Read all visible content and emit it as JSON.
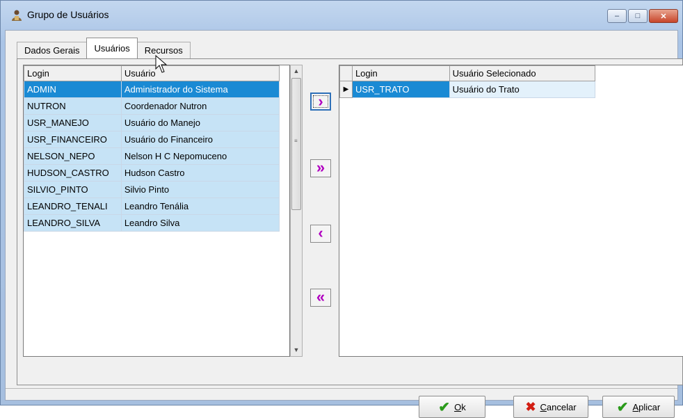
{
  "window": {
    "title": "Grupo de Usuários",
    "controls": {
      "minimize": "–",
      "maximize": "□",
      "close": "✕"
    }
  },
  "tabs": [
    {
      "label": "Dados Gerais",
      "active": false
    },
    {
      "label": "Usuários",
      "active": true
    },
    {
      "label": "Recursos",
      "active": false
    }
  ],
  "left_grid": {
    "columns": [
      "Login",
      "Usuário"
    ],
    "rows": [
      {
        "login": "ADMIN",
        "name": "Administrador do Sistema",
        "selected": true
      },
      {
        "login": "NUTRON",
        "name": "Coordenador Nutron"
      },
      {
        "login": "USR_MANEJO",
        "name": "Usuário do Manejo"
      },
      {
        "login": "USR_FINANCEIRO",
        "name": "Usuário do Financeiro"
      },
      {
        "login": "NELSON_NEPO",
        "name": "Nelson H C Nepomuceno"
      },
      {
        "login": "HUDSON_CASTRO",
        "name": "Hudson Castro"
      },
      {
        "login": "SILVIO_PINTO",
        "name": "Silvio Pinto"
      },
      {
        "login": "LEANDRO_TENALI",
        "name": "Leandro Tenália"
      },
      {
        "login": "LEANDRO_SILVA",
        "name": "Leandro Silva"
      }
    ]
  },
  "move_buttons": [
    {
      "symbol": "›",
      "icon": "move-right-icon"
    },
    {
      "symbol": "»",
      "icon": "move-all-right-icon"
    },
    {
      "symbol": "‹",
      "icon": "move-left-icon"
    },
    {
      "symbol": "«",
      "icon": "move-all-left-icon"
    }
  ],
  "right_grid": {
    "columns": [
      "Login",
      "Usuário Selecionado"
    ],
    "rows": [
      {
        "indicator": "▶",
        "login": "USR_TRATO",
        "name": "Usuário do Trato"
      }
    ]
  },
  "footer": {
    "ok": {
      "accel": "O",
      "rest": "k"
    },
    "cancel": {
      "accel": "C",
      "rest": "ancelar"
    },
    "apply": {
      "accel": "A",
      "rest": "plicar"
    }
  },
  "colors": {
    "selection": "#1a8ad4",
    "row_fill": "#c6e3f6",
    "arrow_magenta": "#b000c0",
    "check_green": "#2a9a1a",
    "cancel_red": "#d21d12"
  }
}
